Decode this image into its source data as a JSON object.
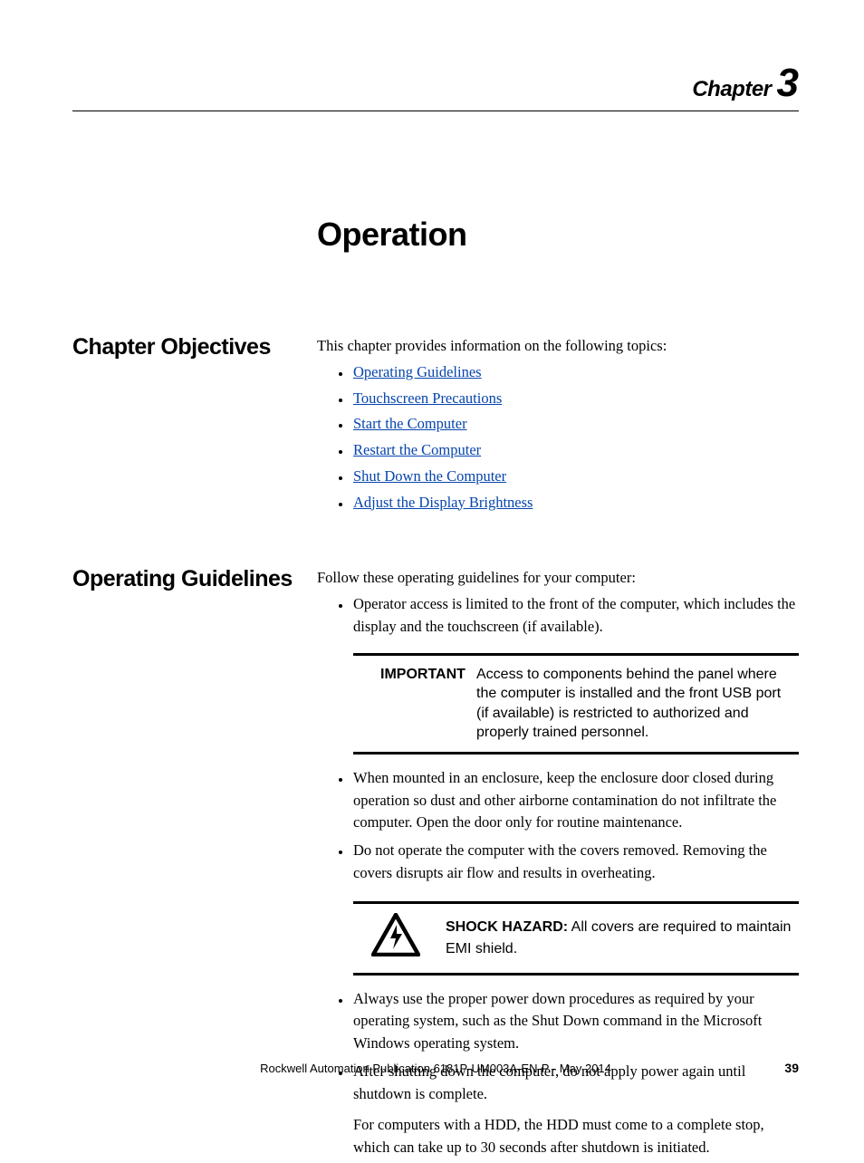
{
  "header": {
    "chapter_label": "Chapter",
    "chapter_number": "3"
  },
  "title": "Operation",
  "sections": {
    "objectives": {
      "heading": "Chapter Objectives",
      "intro": "This chapter provides information on the following topics:",
      "links": [
        "Operating Guidelines",
        "Touchscreen Precautions",
        "Start the Computer",
        "Restart the Computer",
        "Shut Down the Computer",
        "Adjust the Display Brightness"
      ]
    },
    "guidelines": {
      "heading": "Operating Guidelines",
      "intro": "Follow these operating guidelines for your computer:",
      "bullet1": "Operator access is limited to the front of the computer, which includes the display and the touchscreen (if available).",
      "important_label": "IMPORTANT",
      "important_body": "Access to components behind the panel where the computer is installed and the front USB port (if available) is restricted to authorized and properly trained personnel.",
      "bullet2": "When mounted in an enclosure, keep the enclosure door closed during operation so dust and other airborne contamination do not infiltrate the computer. Open the door only for routine maintenance.",
      "bullet3": "Do not operate the computer with the covers removed. Removing the covers disrupts air flow and results in overheating.",
      "shock_label": "SHOCK HAZARD:",
      "shock_body": " All covers are required to maintain EMI shield.",
      "bullet4": "Always use the proper power down procedures as required by your operating system, such as the Shut Down command in the Microsoft Windows operating system.",
      "bullet5": "After shutting down the computer, do not apply power again until shutdown is complete.",
      "hdd_note": "For computers with a HDD, the HDD must come to a complete stop, which can take up to 30 seconds after shutdown is initiated."
    }
  },
  "footer": {
    "publication": "Rockwell Automation Publication 6181P-UM003A-EN-P - May 2014",
    "page": "39"
  }
}
